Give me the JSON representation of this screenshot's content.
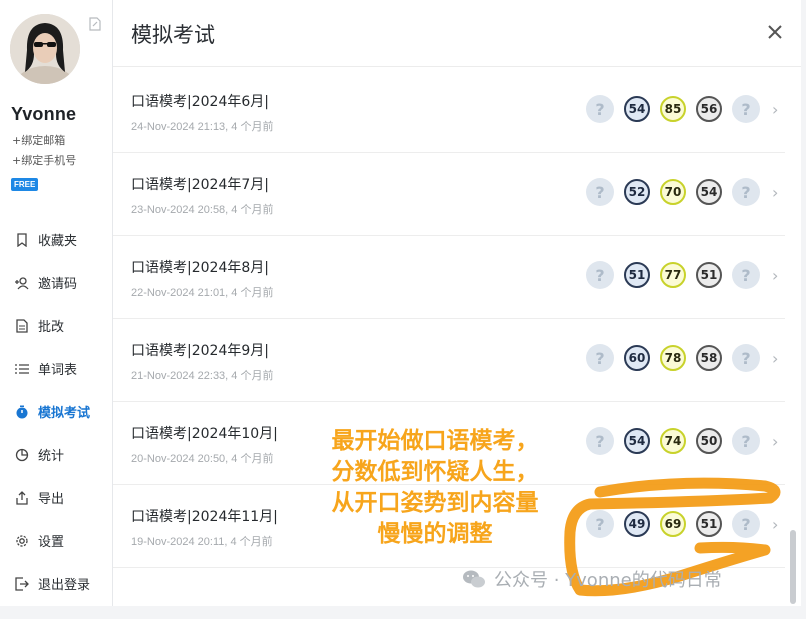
{
  "sidebar": {
    "username": "Yvonne",
    "bind_email": "+绑定邮箱",
    "bind_phone": "+绑定手机号",
    "badge": "FREE",
    "items": [
      {
        "label": "收藏夹",
        "icon": "bookmark-icon"
      },
      {
        "label": "邀请码",
        "icon": "users-plus-icon"
      },
      {
        "label": "批改",
        "icon": "document-icon"
      },
      {
        "label": "单词表",
        "icon": "list-icon"
      },
      {
        "label": "模拟考试",
        "icon": "stopwatch-icon",
        "active": true
      },
      {
        "label": "统计",
        "icon": "pie-chart-icon"
      },
      {
        "label": "导出",
        "icon": "export-icon"
      },
      {
        "label": "设置",
        "icon": "gear-icon"
      },
      {
        "label": "退出登录",
        "icon": "logout-icon"
      }
    ]
  },
  "panel": {
    "title": "模拟考试",
    "close_icon": "close-icon"
  },
  "exams": [
    {
      "title": "口语模考|2024年6月|",
      "meta": "24-Nov-2024 21:13, 4 个月前",
      "scores": [
        "54",
        "85",
        "56"
      ]
    },
    {
      "title": "口语模考|2024年7月|",
      "meta": "23-Nov-2024 20:58, 4 个月前",
      "scores": [
        "52",
        "70",
        "54"
      ]
    },
    {
      "title": "口语模考|2024年8月|",
      "meta": "22-Nov-2024 21:01, 4 个月前",
      "scores": [
        "51",
        "77",
        "51"
      ]
    },
    {
      "title": "口语模考|2024年9月|",
      "meta": "21-Nov-2024 22:33, 4 个月前",
      "scores": [
        "60",
        "78",
        "58"
      ]
    },
    {
      "title": "口语模考|2024年10月|",
      "meta": "20-Nov-2024 20:50, 4 个月前",
      "scores": [
        "54",
        "74",
        "50"
      ]
    },
    {
      "title": "口语模考|2024年11月|",
      "meta": "19-Nov-2024 20:11, 4 个月前",
      "scores": [
        "49",
        "69",
        "51"
      ]
    }
  ],
  "placeholder_glyph": "?",
  "chevron_glyph": "›",
  "annotation": {
    "lines": [
      "最开始做口语模考，",
      "分数低到怀疑人生，",
      "从开口姿势到内容量",
      "慢慢的调整"
    ],
    "color": "#f7a51c"
  },
  "watermark": {
    "text": "公众号 · Yvonne的代码日常",
    "icon": "wechat-icon"
  },
  "colors": {
    "accent": "#1976d2",
    "score_ring_dark": "#2b3a55",
    "score_ring_yellow": "#c8d22b",
    "score_ring_gray": "#555555"
  }
}
